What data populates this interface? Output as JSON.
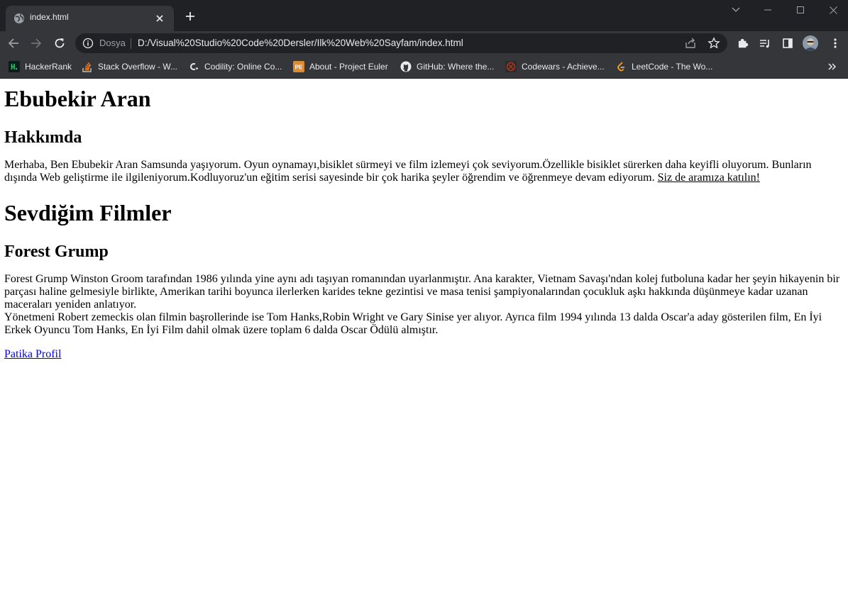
{
  "browser": {
    "tab": {
      "title": "index.html"
    },
    "omnibox": {
      "security_chip": "Dosya",
      "url": "D:/Visual%20Studio%20Code%20Dersler/Ilk%20Web%20Sayfam/index.html"
    },
    "bookmarks": [
      {
        "label": "HackerRank",
        "icon": "hackerrank-icon"
      },
      {
        "label": "Stack Overflow - W...",
        "icon": "stackoverflow-icon"
      },
      {
        "label": "Codility: Online Co...",
        "icon": "codility-icon"
      },
      {
        "label": "About - Project Euler",
        "icon": "project-euler-icon"
      },
      {
        "label": "GitHub: Where the...",
        "icon": "github-icon"
      },
      {
        "label": "Codewars - Achieve...",
        "icon": "codewars-icon"
      },
      {
        "label": "LeetCode - The Wo...",
        "icon": "leetcode-icon"
      }
    ],
    "colors": {
      "frame": "#202124",
      "toolbar": "#35363a",
      "text": "#e8eaed"
    }
  },
  "page": {
    "name": "Ebubekir Aran",
    "about_heading": "Hakkımda",
    "about_text": "Merhaba, Ben Ebubekir Aran Samsunda yaşıyorum. Oyun oynamayı,bisiklet sürmeyi ve film izlemeyi çok seviyorum.Özellikle bisiklet sürerken daha keyifli oluyorum. Bunların dışında Web geliştirme ile ilgileniyorum.Kodluyoruz'un eğitim serisi sayesinde bir çok harika şeyler öğrendim ve öğrenmeye devam ediyorum.",
    "about_link": "Siz de aramıza katılın!",
    "films_heading": "Sevdiğim Filmler",
    "film_title": "Forest Grump",
    "film_text_1": "Forest Grump Winston Groom tarafından 1986 yılında yine aynı adı taşıyan romanından uyarlanmıştır. Ana karakter, Vietnam Savaşı'ndan kolej futboluna kadar her şeyin hikayenin bir parçası haline gelmesiyle birlikte, Amerikan tarihi boyunca ilerlerken karides tekne gezintisi ve masa tenisi şampiyonalarından çocukluk aşkı hakkında düşünmeye kadar uzanan maceraları yeniden anlatıyor.",
    "film_text_2": "Yönetmeni Robert zemeckis olan filmin başrollerinde ise Tom Hanks,Robin Wright ve Gary Sinise yer alıyor. Ayrıca film 1994 yılında 13 dalda Oscar'a aday gösterilen film, En İyi Erkek Oyuncu Tom Hanks, En İyi Film dahil olmak üzere toplam 6 dalda Oscar Ödülü almıştır.",
    "profile_link": "Patika Profil",
    "link_color": "#0000ee"
  }
}
